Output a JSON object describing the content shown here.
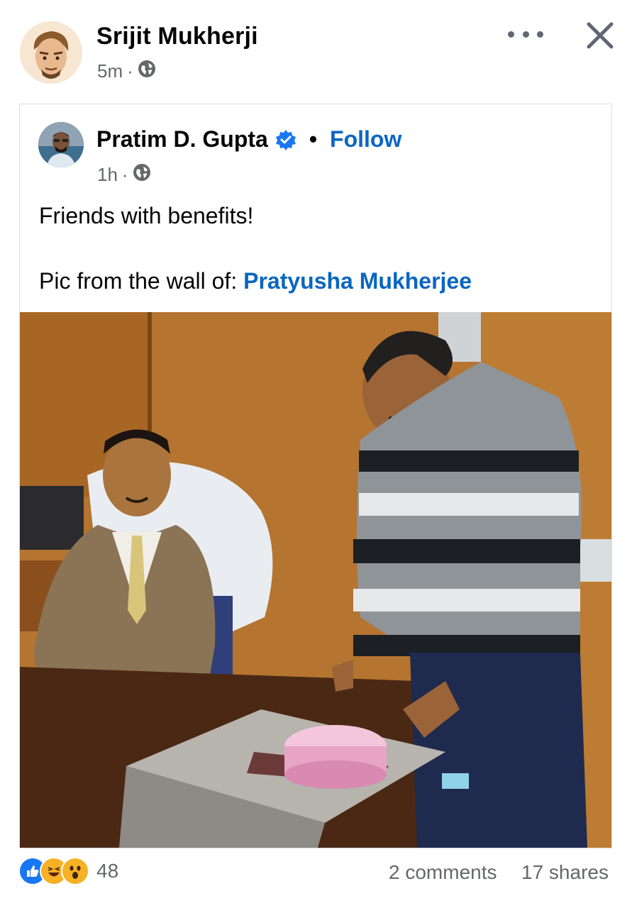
{
  "outer_post": {
    "author": "Srijit Mukherji",
    "time": "5m",
    "separator": "·",
    "privacy_icon": "globe-icon"
  },
  "shared_post": {
    "author": "Pratim D. Gupta",
    "verified_icon": "verified-badge-icon",
    "separator": "•",
    "follow_label": "Follow",
    "time": "1h",
    "meta_separator": "·",
    "privacy_icon": "globe-icon",
    "text_line1": "Friends with benefits!",
    "text_line2_prefix": "Pic from the wall of: ",
    "mention": "Pratyusha Mukherjee"
  },
  "footer": {
    "reaction_icons": [
      "like-icon",
      "laugh-icon",
      "wow-icon"
    ],
    "reaction_count": "48",
    "comments": "2 comments",
    "shares": "17 shares"
  },
  "colors": {
    "link": "#0a66c2",
    "meta_text": "#65676b",
    "like_blue": "#1877f2",
    "reaction_yellow": "#f7b125"
  }
}
